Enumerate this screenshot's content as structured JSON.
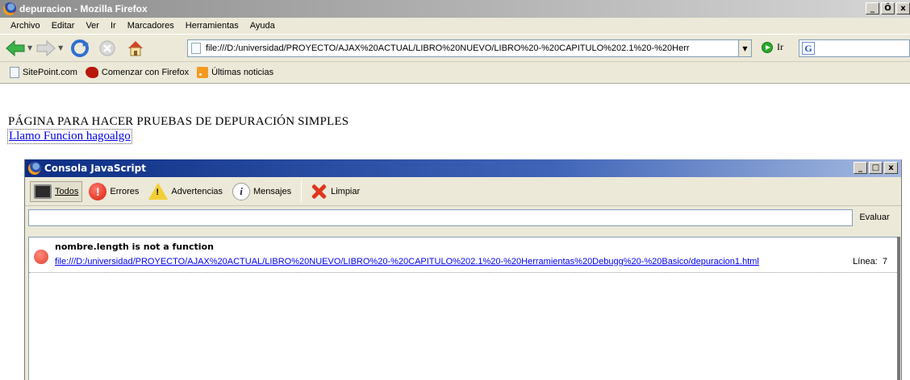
{
  "browser": {
    "title": "depuracion - Mozilla Firefox",
    "window_buttons": [
      "_",
      "Ő",
      "x"
    ],
    "menu": [
      "Archivo",
      "Editar",
      "Ver",
      "Ir",
      "Marcadores",
      "Herramientas",
      "Ayuda"
    ],
    "url": "file:///D:/universidad/PROYECTO/AJAX%20ACTUAL/LIBRO%20NUEVO/LIBRO%20-%20CAPITULO%202.1%20-%20Herr",
    "go_label": "Ir",
    "search_engine_icon": "G",
    "bookmarks": [
      {
        "label": "SitePoint.com",
        "icon": "page-icon"
      },
      {
        "label": "Comenzar con Firefox",
        "icon": "firefox-icon"
      },
      {
        "label": "Últimas noticias",
        "icon": "rss-icon"
      }
    ]
  },
  "page": {
    "heading": "PÁGINA PARA HACER PRUEBAS DE DEPURACIÓN SIMPLES",
    "link": "Llamo Funcion hagoalgo"
  },
  "console": {
    "title": "Consola JavaScript",
    "window_buttons": [
      "_",
      "□",
      "x"
    ],
    "toolbar": {
      "all": "Todos",
      "errors": "Errores",
      "warnings": "Advertencias",
      "messages": "Mensajes",
      "clear": "Limpiar"
    },
    "eval_input_value": "",
    "eval_label": "Evaluar",
    "messages": [
      {
        "text": "nombre.length is not a function",
        "source": "file:///D:/universidad/PROYECTO/AJAX%20ACTUAL/LIBRO%20NUEVO/LIBRO%20-%20CAPITULO%202.1%20-%20Herramientas%20Debugg%20-%20Basico/depuracion1.html",
        "line_label": "Línea:",
        "line": "7",
        "type": "error"
      }
    ]
  },
  "colors": {
    "titlebar_inactive": "#a9a9a9",
    "console_titlebar": "#0a3fb8",
    "chrome_bg": "#ece9d8",
    "link": "#0000ee",
    "error": "#e0412f"
  }
}
